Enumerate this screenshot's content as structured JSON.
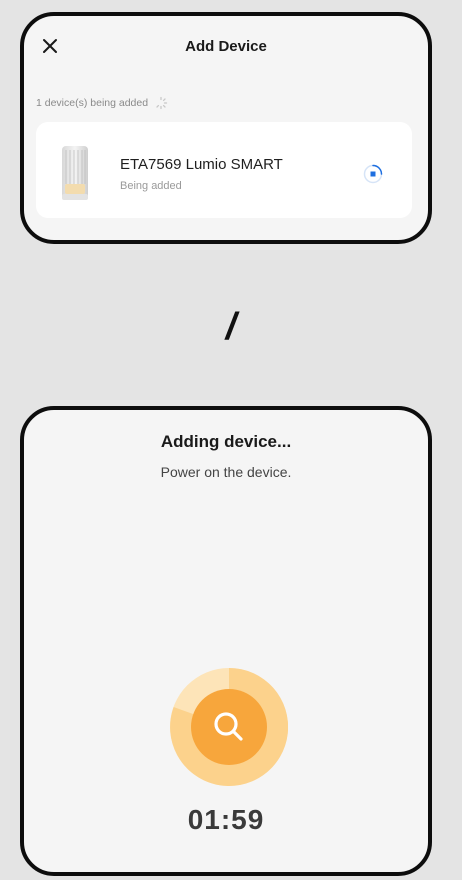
{
  "add_device_screen": {
    "title": "Add Device",
    "close_icon": "close-icon",
    "status_text": "1 device(s) being added",
    "device": {
      "name": "ETA7569 Lumio SMART",
      "status": "Being added"
    }
  },
  "separator_text": "/",
  "adding_screen": {
    "title": "Adding device...",
    "subtitle": "Power on the device.",
    "search_icon": "search-icon",
    "timer": "01:59"
  },
  "colors": {
    "accent_orange": "#f7a63c",
    "ring_orange": "#fcd28c",
    "progress_blue": "#1e6fe0",
    "panel_bg": "#f5f5f5",
    "page_bg": "#e4e4e4"
  }
}
